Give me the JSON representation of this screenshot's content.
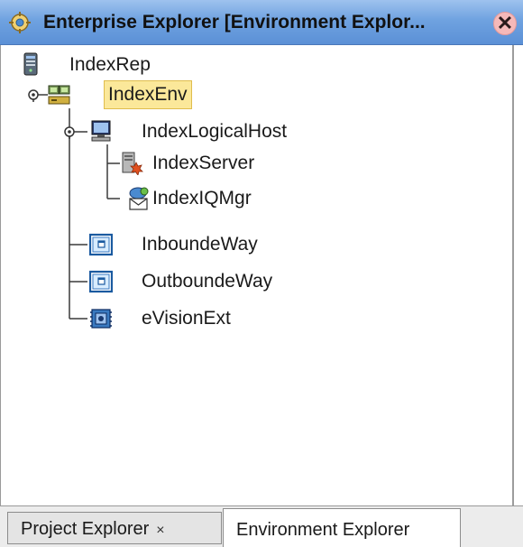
{
  "window": {
    "title": "Enterprise Explorer [Environment Explor...",
    "close_symbol": "✕",
    "icon": "explorer-gear-icon"
  },
  "tree": {
    "nodes": [
      {
        "label": "IndexRep",
        "icon": "repository-server-icon"
      },
      {
        "label": "IndexEnv",
        "icon": "environment-icon",
        "selected": true
      },
      {
        "label": "IndexLogicalHost",
        "icon": "logical-host-computer-icon"
      },
      {
        "label": "IndexServer",
        "icon": "integration-server-icon"
      },
      {
        "label": "IndexIQMgr",
        "icon": "message-server-icon"
      },
      {
        "label": "InboundeWay",
        "icon": "external-system-icon"
      },
      {
        "label": "OutboundeWay",
        "icon": "external-system-icon"
      },
      {
        "label": "eVisionExt",
        "icon": "evision-external-icon"
      }
    ]
  },
  "tabs": {
    "project_label": "Project Explorer",
    "project_close": "×",
    "environment_label": "Environment Explorer",
    "active": "Environment Explorer"
  },
  "colors": {
    "titlebar": "#6fa2e0",
    "selection": "#fbe89a",
    "tree_lines": "#3a3a3a"
  }
}
